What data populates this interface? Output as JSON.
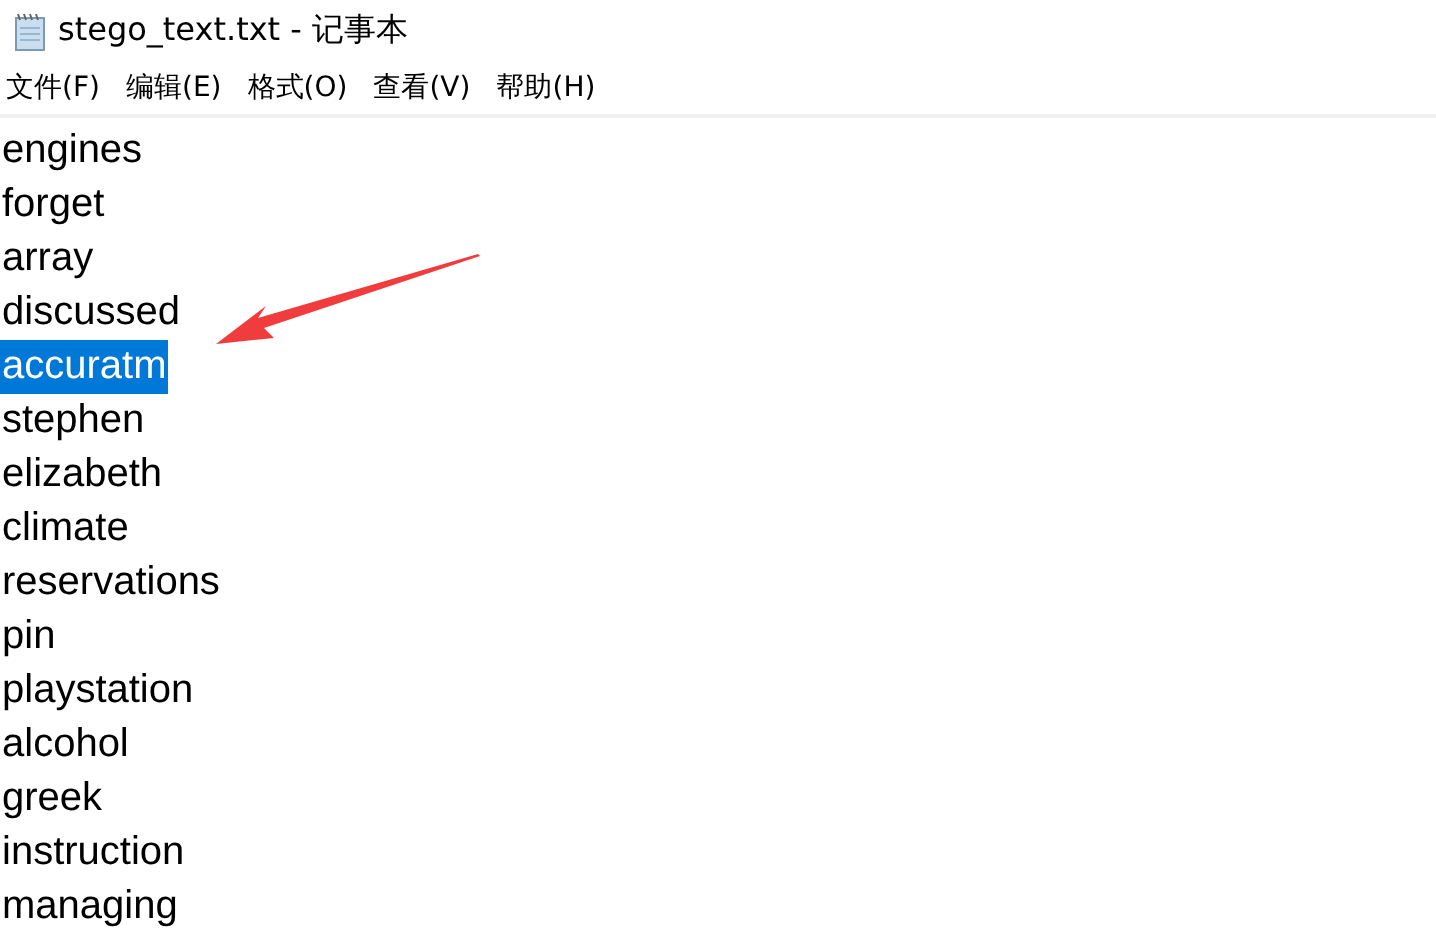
{
  "window": {
    "title": "stego_text.txt - 记事本"
  },
  "menu": [
    "文件(F)",
    "编辑(E)",
    "格式(O)",
    "查看(V)",
    "帮助(H)"
  ],
  "lines": [
    {
      "text": "engines",
      "selected": false
    },
    {
      "text": "forget",
      "selected": false
    },
    {
      "text": "array",
      "selected": false
    },
    {
      "text": "discussed",
      "selected": false
    },
    {
      "text": "accuratm",
      "selected": true
    },
    {
      "text": "stephen",
      "selected": false
    },
    {
      "text": "elizabeth",
      "selected": false
    },
    {
      "text": "climate",
      "selected": false
    },
    {
      "text": "reservations",
      "selected": false
    },
    {
      "text": "pin",
      "selected": false
    },
    {
      "text": "playstation",
      "selected": false
    },
    {
      "text": "alcohol",
      "selected": false
    },
    {
      "text": "greek",
      "selected": false
    },
    {
      "text": "instruction",
      "selected": false
    },
    {
      "text": "managing",
      "selected": false
    }
  ]
}
